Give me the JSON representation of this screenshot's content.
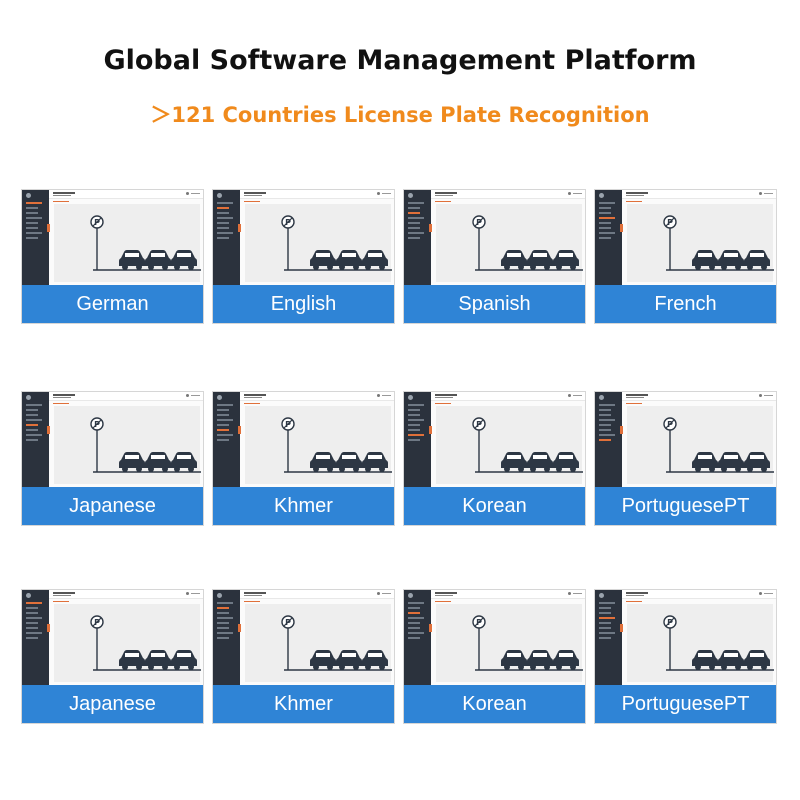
{
  "header": {
    "title": "Global Software Management Platform",
    "subtitle": "＞121 Countries License Plate Recognition",
    "subtitle_color": "#f08a1c"
  },
  "colors": {
    "banner": "#2f84d6",
    "sidebar": "#2b323d",
    "accent": "#e0703a"
  },
  "cards": [
    {
      "language": "German"
    },
    {
      "language": "English"
    },
    {
      "language": "Spanish"
    },
    {
      "language": "French"
    },
    {
      "language": "Japanese"
    },
    {
      "language": "Khmer"
    },
    {
      "language": "Korean"
    },
    {
      "language": "PortuguesePT"
    },
    {
      "language": "Japanese"
    },
    {
      "language": "Khmer"
    },
    {
      "language": "Korean"
    },
    {
      "language": "PortuguesePT"
    }
  ],
  "icons": {
    "scene": "parking-sign-cars-icon"
  }
}
